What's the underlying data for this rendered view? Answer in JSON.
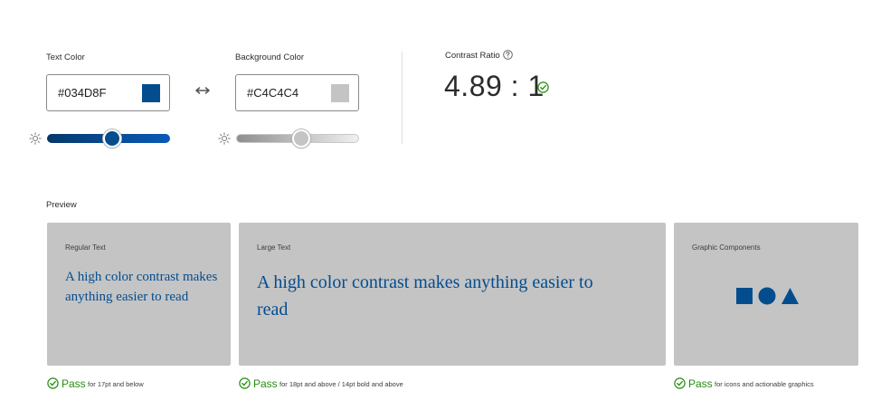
{
  "text_color": {
    "label": "Text Color",
    "value": "#034D8F",
    "swatch": "#034d8f",
    "slider_level": 0.53,
    "track_from": "#05396c",
    "track_to": "#0a5ab8"
  },
  "background_color": {
    "label": "Background Color",
    "value": "#C4C4C4",
    "swatch": "#c4c4c4",
    "slider_level": 0.53,
    "track_from": "#8e8e8e",
    "track_to": "#f0f0f0"
  },
  "contrast": {
    "label": "Contrast Ratio",
    "value": "4.89 : 1",
    "status": "pass"
  },
  "preview": {
    "label": "Preview",
    "text_color": "#034d8f",
    "bg_color": "#c4c4c4",
    "cards": [
      {
        "label": "Regular Text",
        "text": "A high color contrast makes anything easier to read",
        "pass": "Pass",
        "desc": "for 17pt and below"
      },
      {
        "label": "Large Text",
        "text": "A high color contrast makes anything easier to read",
        "pass": "Pass",
        "desc": "for 18pt and above / 14pt bold and above"
      },
      {
        "label": "Graphic Components",
        "shapes": [
          "square",
          "circle",
          "triangle"
        ],
        "pass": "Pass",
        "desc": "for icons and actionable graphics"
      }
    ]
  },
  "icons": {
    "brightness": "sun-icon",
    "swap": "swap-arrows-icon",
    "help": "question-circle-icon",
    "check": "check-circle-icon"
  },
  "colors": {
    "pass_green": "#268e0f"
  }
}
